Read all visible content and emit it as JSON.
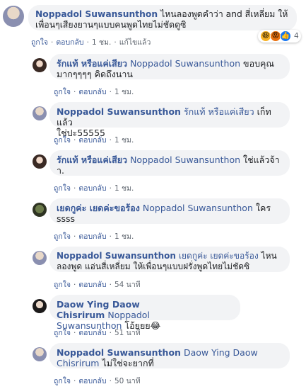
{
  "colors": {
    "link": "#385898",
    "bubble": "#f2f3f5",
    "text": "#1c1e21",
    "meta": "#606770"
  },
  "comments": [
    {
      "author": "Noppadol Suwansunthon",
      "text_line1": "ไหนลองพูดคำว่า and สี่เหลี่ยม ให้",
      "text_line2": "เพื่อนๆเสียงยานๆแบบคนพูดไทยไม่ชัดดูซิ",
      "like": "ถูกใจ",
      "reply": "ตอบกลับ",
      "time": "1 ชม.",
      "edited": "แก้ไขแล้ว",
      "reaction_count": "4",
      "reaction_icons": [
        "haha-icon",
        "angry-icon",
        "like-icon"
      ]
    },
    {
      "author": "รักแท้ หรือแค่เสียว",
      "tag": "Noppadol Suwansunthon",
      "text": "ขอบคุณ",
      "text_line2": "มากๆๆๆๆ คิดถึงนาน",
      "like": "ถูกใจ",
      "reply": "ตอบกลับ",
      "time": "1 ชม."
    },
    {
      "author": "Noppadol Suwansunthon",
      "tag": "รักแท้ หรือแค่เสียว",
      "text": "เก็ทแล้ว",
      "text_line2": "ใช่ปะ55555",
      "like": "ถูกใจ",
      "reply": "ตอบกลับ",
      "time": "1 ชม."
    },
    {
      "author": "รักแท้ หรือแค่เสียว",
      "tag": "Noppadol Suwansunthon",
      "text": "ใช่แล้วจ้า",
      "text_line2": "า.",
      "like": "ถูกใจ",
      "reply": "ตอบกลับ",
      "time": "1 ชม."
    },
    {
      "author": "เยดกูค่ะ เยดค่ะขอร้อง",
      "tag": "Noppadol Suwansunthon",
      "text": "ใคร",
      "text_line2": "ssss",
      "like": "ถูกใจ",
      "reply": "ตอบกลับ",
      "time": "1 ชม."
    },
    {
      "author": "Noppadol Suwansunthon",
      "tag": "เยดกูค่ะ เยดค่ะขอร้อง",
      "text": "ไหน",
      "text_line2": "ลองพูด แอ่นสี่เหลี่ยม ให้เพื่อนๆแบบฝรั่งพูดไทยไม่ชัดซิ",
      "like": "ถูกใจ",
      "reply": "ตอบกลับ",
      "time": "54 นาที"
    },
    {
      "author": "Daow Ying Daow Chisrirum",
      "tag": "Noppadol",
      "tag_line2": "Suwansunthon",
      "text": "โอ้ยยย😂",
      "like": "ถูกใจ",
      "reply": "ตอบกลับ",
      "time": "51 นาที"
    },
    {
      "author": "Noppadol Suwansunthon",
      "tag": "Daow Ying Daow",
      "tag_line2": "Chisrirum",
      "text": "ไม่ใช่จะยากที่",
      "like": "ถูกใจ",
      "reply": "ตอบกลับ",
      "time": "50 นาที"
    }
  ]
}
